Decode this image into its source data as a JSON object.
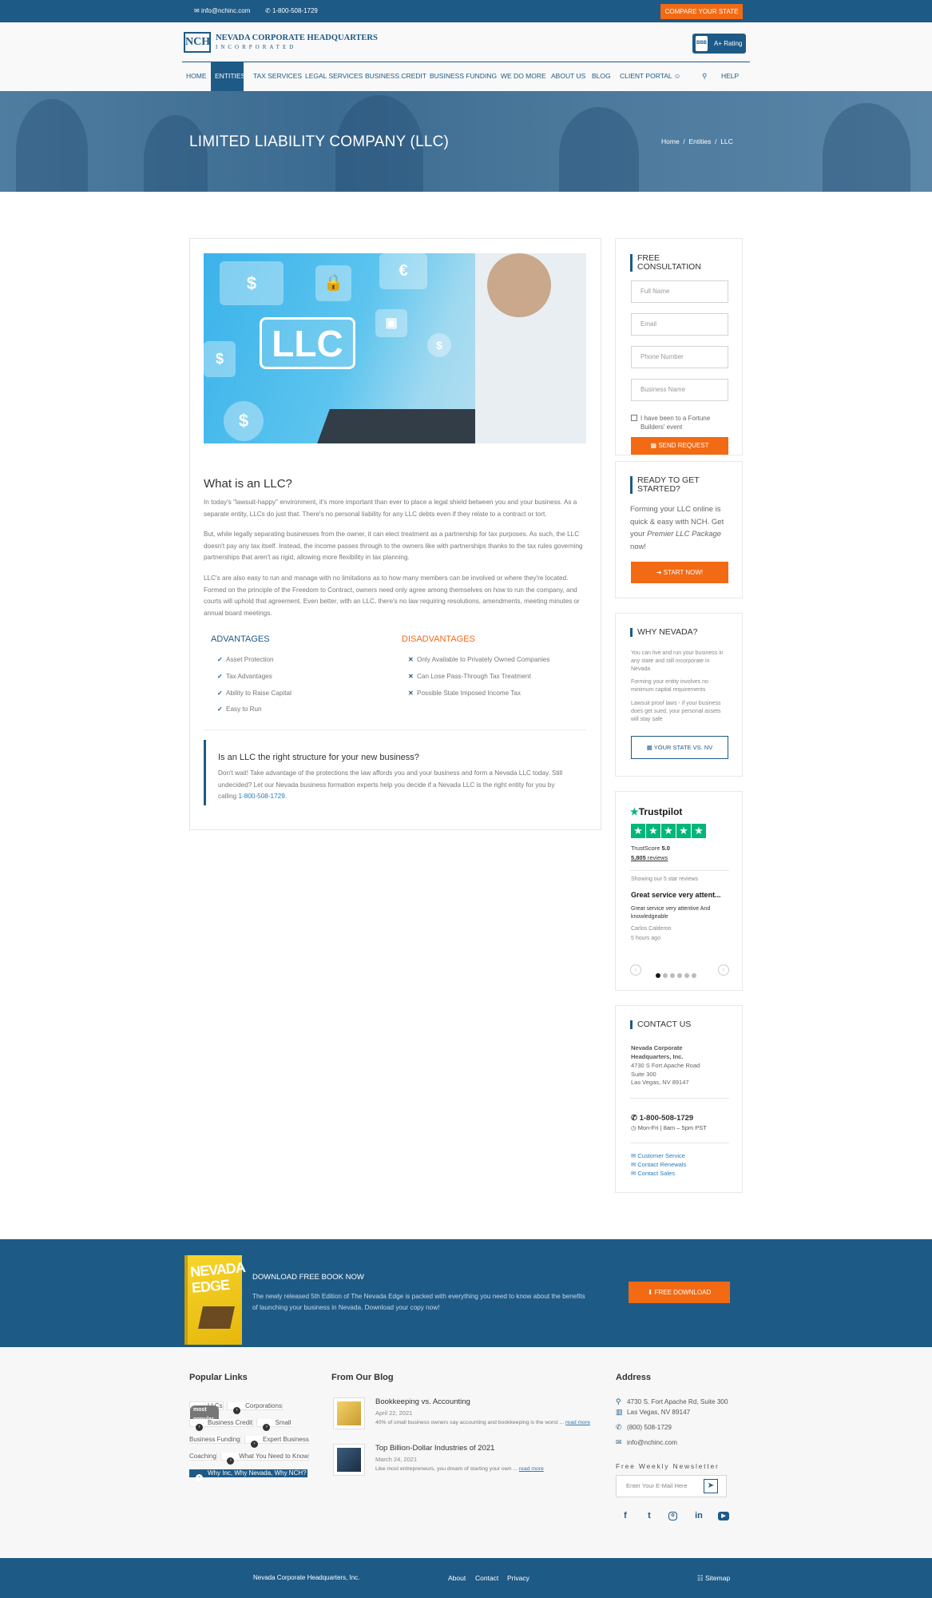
{
  "topbar": {
    "email": "info@nchinc.com",
    "phone": "1-800-508-1729",
    "compare_btn": "COMPARE YOUR STATE"
  },
  "logo": {
    "mark": "NCH",
    "line1": "NEVADA CORPORATE HEADQUARTERS",
    "line2": "INCORPORATED"
  },
  "bbb": {
    "mark": "BBB",
    "label": "A+ Rating"
  },
  "nav": {
    "items": [
      "HOME",
      "ENTITIES",
      "TAX SERVICES",
      "LEGAL SERVICES",
      "BUSINESS CREDIT",
      "BUSINESS FUNDING",
      "WE DO MORE",
      "ABOUT US",
      "BLOG",
      "CLIENT PORTAL",
      "HELP"
    ],
    "active": "ENTITIES"
  },
  "hero": {
    "title": "LIMITED LIABILITY COMPANY (LLC)",
    "breadcrumb": [
      "Home",
      "Entities",
      "LLC"
    ]
  },
  "image": {
    "text": "LLC"
  },
  "article": {
    "heading": "What is an LLC?",
    "p1": "In today's \"lawsuit-happy\" environment, it's more important than ever to place a legal shield between you and your business. As a separate entity, LLCs do just that. There's no personal liability for any LLC debts even if they relate to a contract or tort.",
    "p2": "But, while legally separating businesses from the owner, it can elect treatment as a partnership for tax purposes. As such, the LLC doesn't pay any tax itself. Instead, the income passes through to the owners like with partnerships thanks to the tax rules governing partnerships that aren't as rigid, allowing more flexibility in tax planning.",
    "p3": "LLC's are also easy to run and manage with no limitations as to how many members can be involved or where they're located. Formed on the principle of the Freedom to Contract, owners need only agree among themselves on how to run the company, and courts will uphold that agreement. Even better, with an LLC, there's no law requiring resolutions, amendments, meeting minutes or annual board meetings.",
    "advantages_title": "ADVANTAGES",
    "advantages": [
      "Asset Protection",
      "Tax Advantages",
      "Ability to Raise Capital",
      "Easy to Run"
    ],
    "disadvantages_title": "DISADVANTAGES",
    "disadvantages": [
      "Only Available to Privately Owned Companies",
      "Can Lose Pass-Through Tax Treatment",
      "Possible State Imposed Income Tax"
    ],
    "cta_heading": "Is an LLC the right structure for your new business?",
    "cta_text": "Don't wait! Take advantage of the protections the law affords you and your business and form a Nevada LLC today. Still undecided? Let our Nevada business formation experts help you decide if a Nevada LLC is the right entity for you by calling",
    "cta_phone": "1-800-508-1729",
    "cta_end": "."
  },
  "consult": {
    "title_l1": "FREE",
    "title_l2": "CONSULTATION",
    "placeholders": [
      "Full Name",
      "Email",
      "Phone Number",
      "Business Name"
    ],
    "checkbox_label": "I have been to a Fortune Builders' event",
    "button": "SEND REQUEST"
  },
  "ready": {
    "title_l1": "READY TO GET",
    "title_l2": "STARTED?",
    "text_a": "Forming your LLC online is quick & easy with NCH. Get your ",
    "text_em": "Premier LLC Package",
    "text_b": " now!",
    "button": "START NOW!"
  },
  "why": {
    "title": "WHY NEVADA?",
    "points": [
      "You can live and run your business in any state and still incorporate in Nevada",
      "Forming your entity involves no minimum capital requirements",
      "Lawsuit proof laws - if your business does get sued, your personal assets will stay safe"
    ],
    "button": "YOUR STATE VS. NV"
  },
  "trustpilot": {
    "brand": "Trustpilot",
    "score_label": "TrustScore",
    "score": "5.0",
    "reviews": "5,805",
    "reviews_label": "reviews",
    "showing": "Showing our 5 star reviews",
    "review_title": "Great service very attent...",
    "review_text": "Great service very attentive And knowledgeable",
    "reviewer": "Carlos Calderon",
    "ago": "5 hours ago"
  },
  "contact": {
    "title": "CONTACT US",
    "company_l1": "Nevada Corporate",
    "company_l2": "Headquarters, Inc.",
    "addr1": "4730 S Fort Apache Road",
    "addr2": "Suite 300",
    "addr3": "Las Vegas, NV 89147",
    "phone": "1-800-508-1729",
    "hours": "Mon-Fri | 8am – 5pm PST",
    "links": [
      "Customer Service",
      "Contact Renewals",
      "Contact Sales"
    ]
  },
  "banner": {
    "book_title": "NEVADA EDGE",
    "heading": "DOWNLOAD FREE BOOK NOW",
    "text": "The newly released 5th Edition of The Nevada Edge is packed with everything you need to know about the benefits of launching your business in Nevada. Download your copy now!",
    "button": "FREE DOWNLOAD"
  },
  "footer": {
    "popular_title": "Popular Links",
    "popular": [
      "LLCs",
      "Corporations",
      "Business Credit",
      "Small Business Funding",
      "Expert Business Coaching",
      "What You Need to Know",
      "Why Inc, Why Nevada, Why NCH?"
    ],
    "popular_badge": "most popular",
    "blog_title": "From Our Blog",
    "posts": [
      {
        "title": "Bookkeeping vs. Accounting",
        "date": "April 22, 2021",
        "excerpt": "40% of small business owners say accounting and bookkeeping is the worst ...",
        "more": "read more"
      },
      {
        "title": "Top Billion-Dollar Industries of 2021",
        "date": "March 24, 2021",
        "excerpt": "Like most entrepreneurs, you dream of starting your own ...",
        "more": "read more"
      }
    ],
    "address_title": "Address",
    "addr_l1": "4730 S. Fort Apache Rd, Suite 300",
    "addr_l2": "Las Vegas, NV 89147",
    "phone": "(800) 508-1729",
    "email": "info@nchinc.com",
    "newsletter_title": "Free Weekly Newsletter",
    "newsletter_placeholder": "Enter Your E-Mail Here"
  },
  "bottom": {
    "company": "Nevada Corporate Headquarters, Inc.",
    "links": [
      "About",
      "Contact",
      "Privacy"
    ],
    "sitemap": "Sitemap"
  },
  "colors": {
    "primary": "#1e5a86",
    "accent": "#f26a14",
    "trustpilot": "#00b67a"
  }
}
